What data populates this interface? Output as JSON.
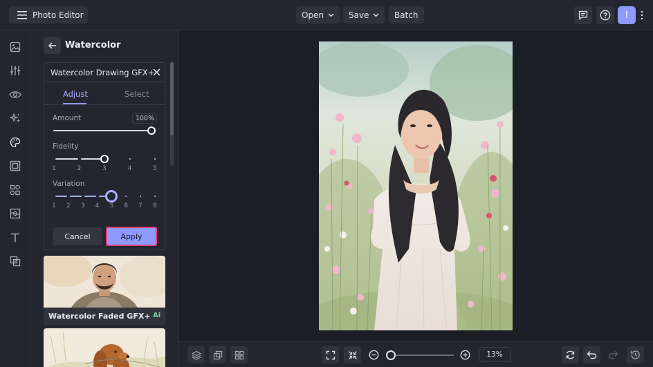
{
  "app": {
    "title": "Photo Editor"
  },
  "topbar": {
    "open_label": "Open",
    "save_label": "Save",
    "batch_label": "Batch",
    "avatar_initial": "I"
  },
  "rail": {
    "icons": [
      "image-icon",
      "sliders-icon",
      "eye-icon",
      "sparkles-icon",
      "palette-icon",
      "frame-icon",
      "shapes-icon",
      "texture-icon",
      "text-icon",
      "overlay-icon"
    ]
  },
  "panel": {
    "title": "Watercolor",
    "effect": {
      "title": "Watercolor Drawing GFX+",
      "tabs": {
        "adjust": "Adjust",
        "select": "Select"
      },
      "amount": {
        "label": "Amount",
        "value": 100,
        "display": "100%"
      },
      "fidelity": {
        "label": "Fidelity",
        "ticks": [
          "1",
          "2",
          "3",
          "4",
          "5"
        ],
        "value": 3
      },
      "variation": {
        "label": "Variation",
        "ticks": [
          "1",
          "2",
          "3",
          "4",
          "5",
          "6",
          "7",
          "8"
        ],
        "value": 5
      },
      "cancel_label": "Cancel",
      "apply_label": "Apply"
    },
    "presets": [
      {
        "name": "Watercolor Faded GFX+",
        "badge": "Ai"
      },
      {
        "name": "",
        "badge": ""
      }
    ]
  },
  "bottombar": {
    "zoom": "13%",
    "zoom_value": 13
  },
  "colors": {
    "accent": "#8e9aff",
    "highlight": "#e4407a",
    "ai_badge": "#7ed4a8",
    "bg": "#1c1e27",
    "panel": "#24262f"
  }
}
